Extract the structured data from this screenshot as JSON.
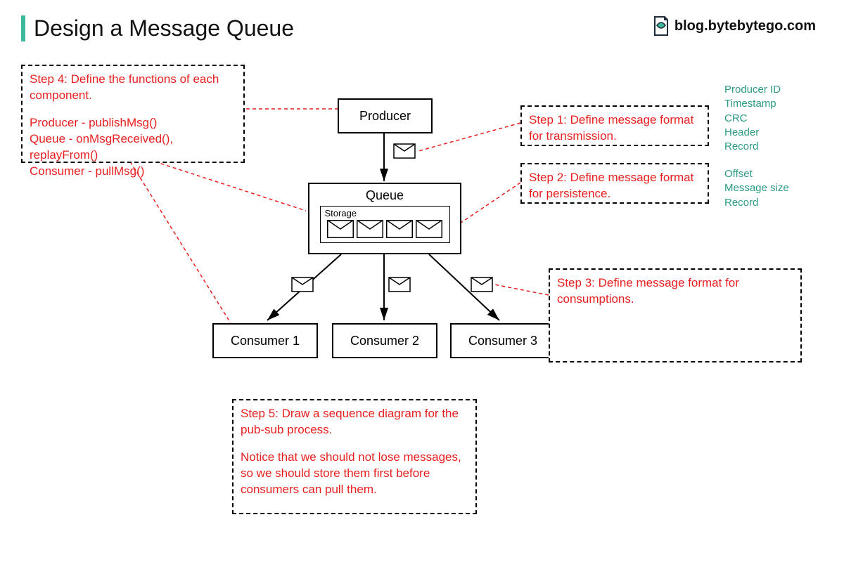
{
  "title": "Design a Message Queue",
  "brand": "blog.bytebytego.com",
  "diagram": {
    "producer": "Producer",
    "queue": "Queue",
    "storage": "Storage",
    "consumer1": "Consumer 1",
    "consumer2": "Consumer 2",
    "consumer3": "Consumer 3"
  },
  "steps": {
    "s1": "Step 1: Define message format for transmission.",
    "s2": "Step 2: Define message format for persistence.",
    "s3": "Step 3: Define message format for consumptions.",
    "s4_a": "Step 4: Define the functions of each component.",
    "s4_b": "Producer - publishMsg()",
    "s4_c": "Queue - onMsgReceived(), replayFrom()",
    "s4_d": "Consumer - pullMsg()",
    "s5_a": "Step 5: Draw a sequence diagram for the pub-sub process.",
    "s5_b": "Notice that we should not lose messages, so we should store them first before consumers can pull them."
  },
  "notes": {
    "transmission": {
      "l1": "Producer ID",
      "l2": "Timestamp",
      "l3": "CRC",
      "l4": "Header",
      "l5": "Record"
    },
    "persistence": {
      "l1": "Offset",
      "l2": "Message size",
      "l3": "Record"
    }
  }
}
